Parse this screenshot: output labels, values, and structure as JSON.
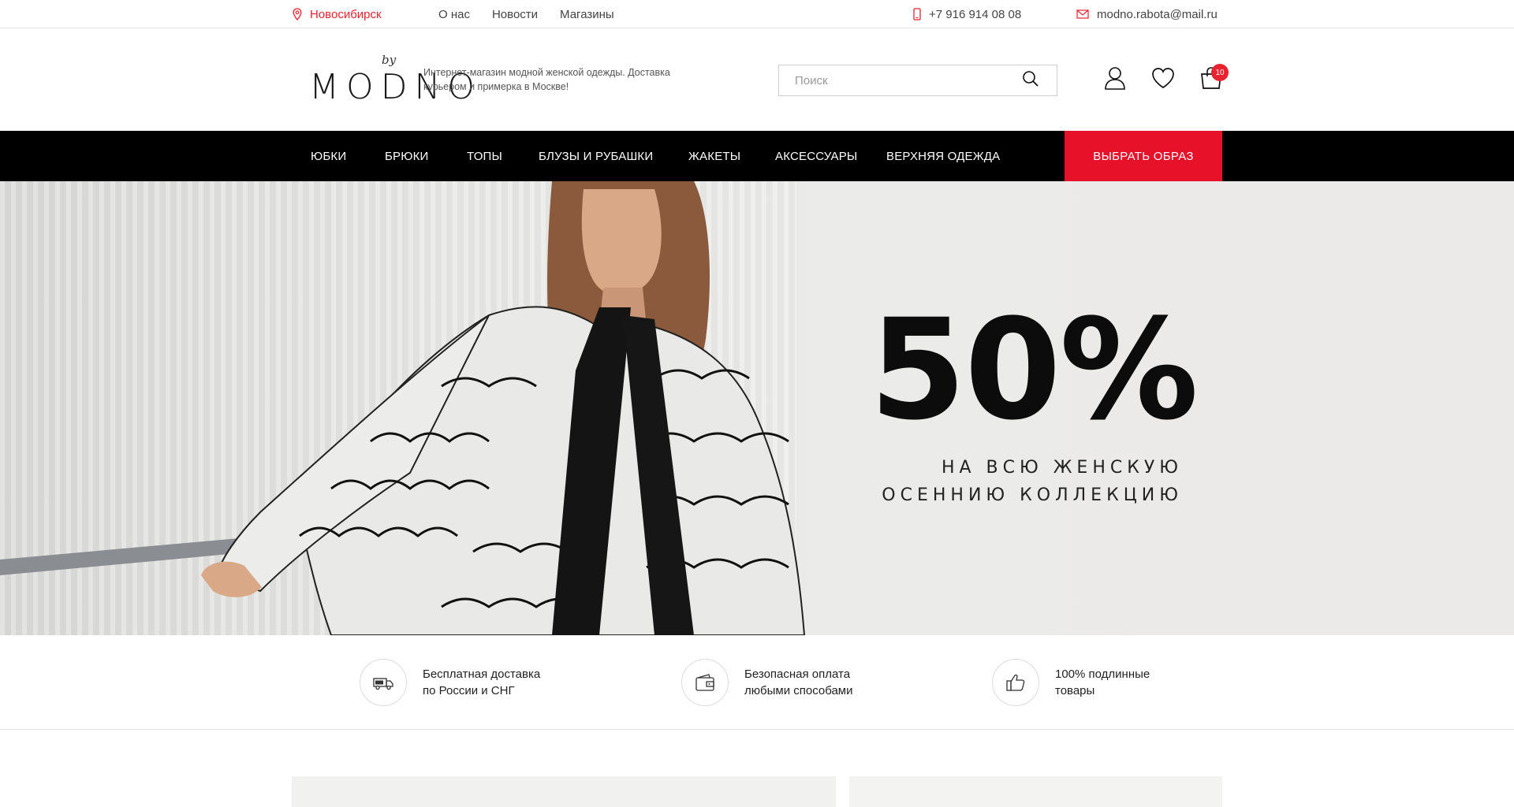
{
  "topbar": {
    "city": "Новосибирск",
    "nav": [
      "О нас",
      "Новости",
      "Магазины"
    ],
    "phone": "+7 916 914 08 08",
    "email": "modno.rabota@mail.ru"
  },
  "header": {
    "logo_by": "by",
    "logo_word": "MODNO",
    "tagline": "Интернет-магазин модной женской одежды. Доставка курьером и примерка в Москве!",
    "search_placeholder": "Поиск",
    "cart_count": "10"
  },
  "mainnav": {
    "items": [
      "ЮБКИ",
      "БРЮКИ",
      "ТОПЫ",
      "БЛУЗЫ И РУБАШКИ",
      "ЖАКЕТЫ",
      "АКСЕССУАРЫ",
      "ВЕРХНЯЯ ОДЕЖДА"
    ],
    "cta": "ВЫБРАТЬ ОБРАЗ"
  },
  "hero": {
    "big": "50%",
    "line1": "НА ВСЮ ЖЕНСКУЮ",
    "line2": "ОСЕННИЮ КОЛЛЕКЦИЮ"
  },
  "features": [
    {
      "icon": "delivery-truck-icon",
      "line1": "Бесплатная доставка",
      "line2": "по России и СНГ"
    },
    {
      "icon": "wallet-icon",
      "line1": "Безопасная оплата",
      "line2": "любыми способами"
    },
    {
      "icon": "thumbs-up-icon",
      "line1": "100% подлинные",
      "line2": "товары"
    }
  ],
  "colors": {
    "accent": "#e8112a",
    "nav_bg": "#000000"
  }
}
